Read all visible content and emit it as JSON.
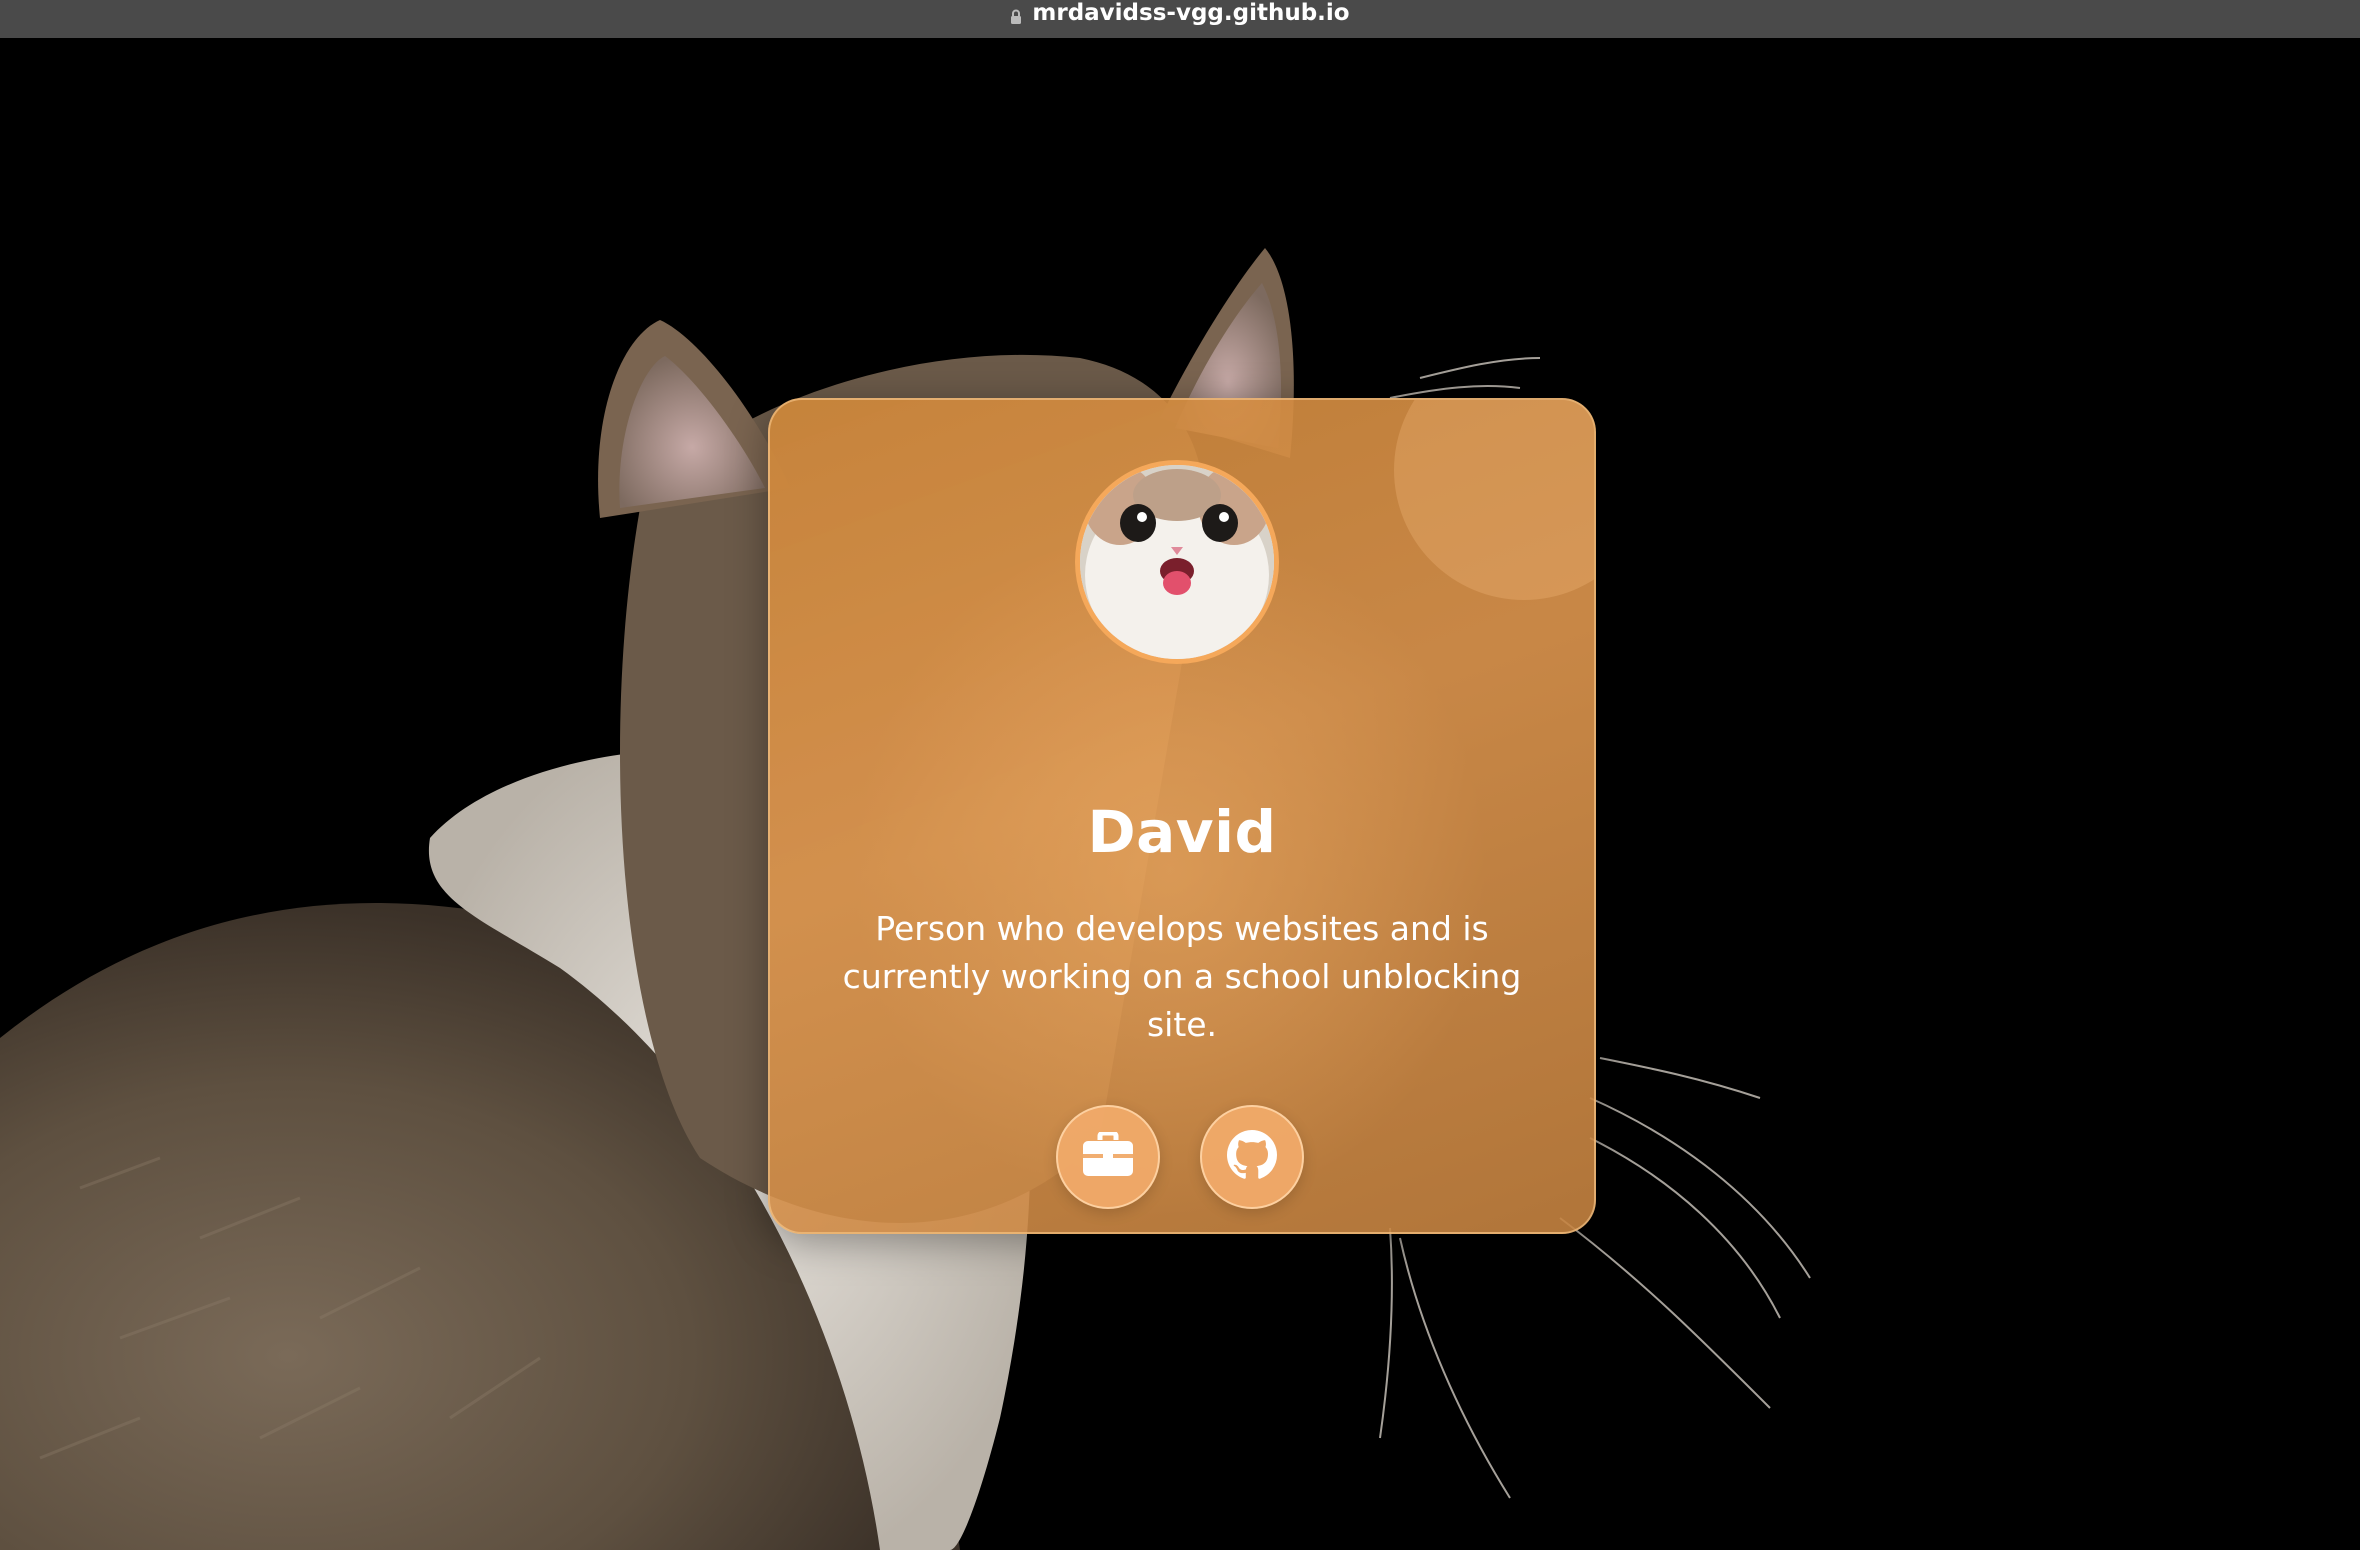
{
  "browser": {
    "url": "mrdavidss-vgg.github.io"
  },
  "profile": {
    "name": "David",
    "description": "Person who develops websites and is currently working on a school unblocking site.",
    "avatar_alt": "cat avatar"
  },
  "links": [
    {
      "icon": "briefcase-icon",
      "label": "Portfolio"
    },
    {
      "icon": "github-icon",
      "label": "GitHub"
    }
  ],
  "colors": {
    "card": "#d28b42",
    "accent": "#f5a85a",
    "background": "#000000",
    "topbar": "#4a4a4a"
  }
}
